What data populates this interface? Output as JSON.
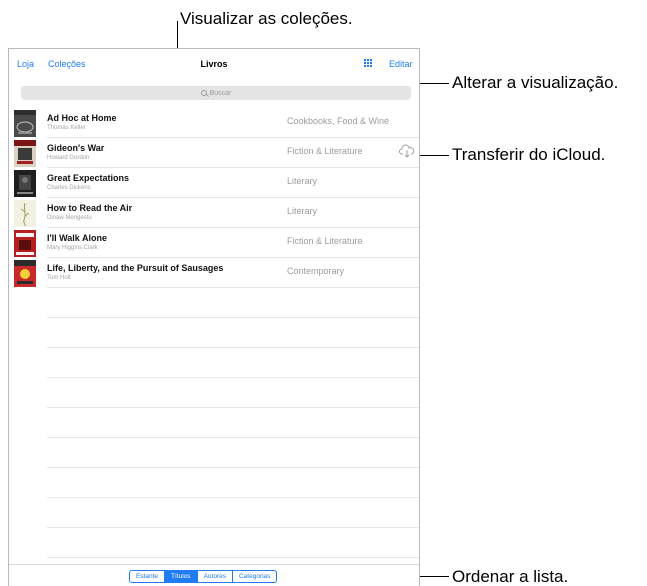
{
  "callouts": {
    "collections": "Visualizar as coleções.",
    "view": "Alterar a visualização.",
    "icloud": "Transferir do iCloud.",
    "sort": "Ordenar a lista."
  },
  "nav": {
    "store": "Loja",
    "collections": "Coleções",
    "title": "Livros",
    "edit": "Editar",
    "view_icon": "grid-icon"
  },
  "search": {
    "placeholder": "Buscar"
  },
  "books": [
    {
      "title": "Ad Hoc at Home",
      "author": "Thomas Keller",
      "category": "Cookbooks, Food & Wine"
    },
    {
      "title": "Gideon's War",
      "author": "Howard Gordon",
      "category": "Fiction & Literature",
      "icon": "icloud-download-icon"
    },
    {
      "title": "Great Expectations",
      "author": "Charles Dickens",
      "category": "Literary"
    },
    {
      "title": "How to Read the Air",
      "author": "Dinaw Mengestu",
      "category": "Literary"
    },
    {
      "title": "I'll Walk Alone",
      "author": "Mary Higgins Clark",
      "category": "Fiction & Literature"
    },
    {
      "title": "Life, Liberty, and the Pursuit of Sausages",
      "author": "Tom Holt",
      "category": "Contemporary"
    }
  ],
  "sort_tabs": [
    "Estante",
    "Títulos",
    "Autores",
    "Categorias"
  ],
  "sort_selected": "Títulos",
  "colors": {
    "accent": "#1f7cf2",
    "separator": "#e6e6e6"
  }
}
